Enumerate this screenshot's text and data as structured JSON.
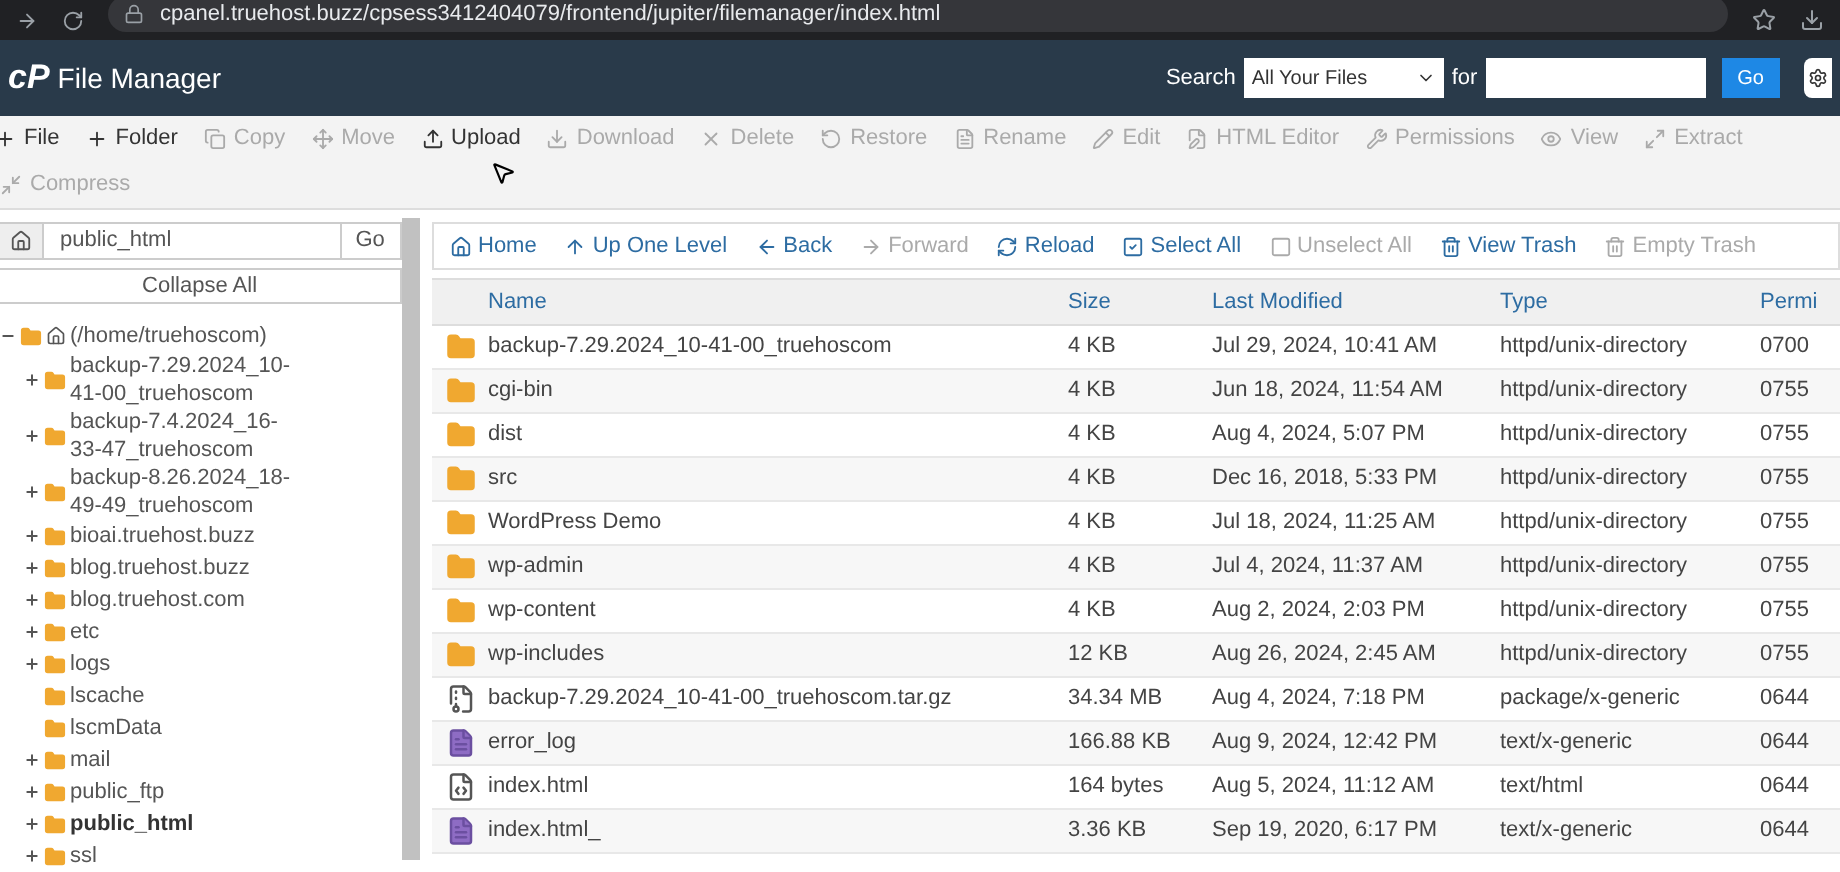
{
  "browser": {
    "url": "cpanel.truehost.buzz/cpsess3412404079/frontend/jupiter/filemanager/index.html"
  },
  "header": {
    "logo": "cP",
    "title": "File Manager",
    "search_label": "Search",
    "search_scope": "All Your Files",
    "for_label": "for",
    "go": "Go"
  },
  "toolbar": [
    {
      "label": "File",
      "disabled": false
    },
    {
      "label": "Folder",
      "disabled": false
    },
    {
      "label": "Copy",
      "disabled": true
    },
    {
      "label": "Move",
      "disabled": true
    },
    {
      "label": "Upload",
      "disabled": false
    },
    {
      "label": "Download",
      "disabled": true
    },
    {
      "label": "Delete",
      "disabled": true
    },
    {
      "label": "Restore",
      "disabled": true
    },
    {
      "label": "Rename",
      "disabled": true
    },
    {
      "label": "Edit",
      "disabled": true
    },
    {
      "label": "HTML Editor",
      "disabled": true
    },
    {
      "label": "Permissions",
      "disabled": true
    },
    {
      "label": "View",
      "disabled": true
    },
    {
      "label": "Extract",
      "disabled": true
    },
    {
      "label": "Compress",
      "disabled": true
    }
  ],
  "sidebar": {
    "path": "public_html",
    "go": "Go",
    "collapse": "Collapse All",
    "tree": {
      "label": "(/home/truehoscom)",
      "expanded": true,
      "children": [
        {
          "label": "backup-7.29.2024_10-41-00_truehoscom",
          "expandable": true,
          "selected": false
        },
        {
          "label": "backup-7.4.2024_16-33-47_truehoscom",
          "expandable": true,
          "selected": false
        },
        {
          "label": "backup-8.26.2024_18-49-49_truehoscom",
          "expandable": true,
          "selected": false
        },
        {
          "label": "bioai.truehost.buzz",
          "expandable": true,
          "selected": false
        },
        {
          "label": "blog.truehost.buzz",
          "expandable": true,
          "selected": false
        },
        {
          "label": "blog.truehost.com",
          "expandable": true,
          "selected": false
        },
        {
          "label": "etc",
          "expandable": true,
          "selected": false
        },
        {
          "label": "logs",
          "expandable": true,
          "selected": false
        },
        {
          "label": "lscache",
          "expandable": false,
          "selected": false
        },
        {
          "label": "lscmData",
          "expandable": false,
          "selected": false
        },
        {
          "label": "mail",
          "expandable": true,
          "selected": false
        },
        {
          "label": "public_ftp",
          "expandable": true,
          "selected": false
        },
        {
          "label": "public_html",
          "expandable": true,
          "selected": true
        },
        {
          "label": "ssl",
          "expandable": true,
          "selected": false
        }
      ]
    }
  },
  "nav": [
    {
      "label": "Home",
      "disabled": false
    },
    {
      "label": "Up One Level",
      "disabled": false
    },
    {
      "label": "Back",
      "disabled": false
    },
    {
      "label": "Forward",
      "disabled": true
    },
    {
      "label": "Reload",
      "disabled": false
    },
    {
      "label": "Select All",
      "disabled": false
    },
    {
      "label": "Unselect All",
      "disabled": true
    },
    {
      "label": "View Trash",
      "disabled": false
    },
    {
      "label": "Empty Trash",
      "disabled": true
    }
  ],
  "table": {
    "columns": [
      "Name",
      "Size",
      "Last Modified",
      "Type",
      "Permi"
    ],
    "rows": [
      {
        "kind": "folder",
        "name": "backup-7.29.2024_10-41-00_truehoscom",
        "size": "4 KB",
        "modified": "Jul 29, 2024, 10:41 AM",
        "type": "httpd/unix-directory",
        "perms": "0700"
      },
      {
        "kind": "folder",
        "name": "cgi-bin",
        "size": "4 KB",
        "modified": "Jun 18, 2024, 11:54 AM",
        "type": "httpd/unix-directory",
        "perms": "0755"
      },
      {
        "kind": "folder",
        "name": "dist",
        "size": "4 KB",
        "modified": "Aug 4, 2024, 5:07 PM",
        "type": "httpd/unix-directory",
        "perms": "0755"
      },
      {
        "kind": "folder",
        "name": "src",
        "size": "4 KB",
        "modified": "Dec 16, 2018, 5:33 PM",
        "type": "httpd/unix-directory",
        "perms": "0755"
      },
      {
        "kind": "folder",
        "name": "WordPress Demo",
        "size": "4 KB",
        "modified": "Jul 18, 2024, 11:25 AM",
        "type": "httpd/unix-directory",
        "perms": "0755"
      },
      {
        "kind": "folder",
        "name": "wp-admin",
        "size": "4 KB",
        "modified": "Jul 4, 2024, 11:37 AM",
        "type": "httpd/unix-directory",
        "perms": "0755"
      },
      {
        "kind": "folder",
        "name": "wp-content",
        "size": "4 KB",
        "modified": "Aug 2, 2024, 2:03 PM",
        "type": "httpd/unix-directory",
        "perms": "0755"
      },
      {
        "kind": "folder",
        "name": "wp-includes",
        "size": "12 KB",
        "modified": "Aug 26, 2024, 2:45 AM",
        "type": "httpd/unix-directory",
        "perms": "0755"
      },
      {
        "kind": "archive",
        "name": "backup-7.29.2024_10-41-00_truehoscom.tar.gz",
        "size": "34.34 MB",
        "modified": "Aug 4, 2024, 7:18 PM",
        "type": "package/x-generic",
        "perms": "0644"
      },
      {
        "kind": "text",
        "name": "error_log",
        "size": "166.88 KB",
        "modified": "Aug 9, 2024, 12:42 PM",
        "type": "text/x-generic",
        "perms": "0644"
      },
      {
        "kind": "html",
        "name": "index.html",
        "size": "164 bytes",
        "modified": "Aug 5, 2024, 11:12 AM",
        "type": "text/html",
        "perms": "0644"
      },
      {
        "kind": "text",
        "name": "index.html_",
        "size": "3.36 KB",
        "modified": "Sep 19, 2020, 6:17 PM",
        "type": "text/x-generic",
        "perms": "0644"
      }
    ]
  }
}
